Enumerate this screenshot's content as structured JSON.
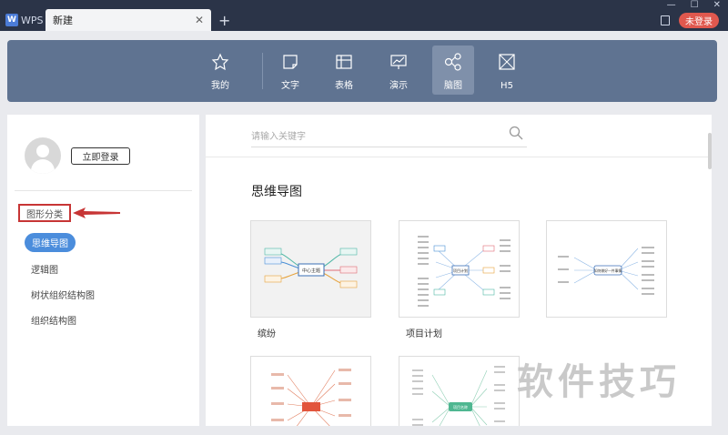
{
  "titlebar": {
    "app_name": "WPS",
    "tab_label": "新建",
    "tab_close": "✕",
    "new_tab": "+",
    "login_badge": "未登录",
    "min": "—",
    "max": "☐",
    "close": "✕"
  },
  "nav": {
    "items": [
      {
        "label": "我的",
        "icon": "star-icon"
      },
      {
        "label": "文字",
        "icon": "document-icon"
      },
      {
        "label": "表格",
        "icon": "table-icon"
      },
      {
        "label": "演示",
        "icon": "presentation-icon"
      },
      {
        "label": "脑图",
        "icon": "mindmap-icon"
      },
      {
        "label": "H5",
        "icon": "h5-icon"
      }
    ],
    "active": "脑图"
  },
  "sidebar": {
    "login_button": "立即登录",
    "category_title": "图形分类",
    "categories": [
      "思维导图",
      "逻辑图",
      "树状组织结构图",
      "组织结构图"
    ]
  },
  "main": {
    "search_placeholder": "请输入关键字",
    "section_title": "思维导图",
    "templates": [
      {
        "label": "缤纷",
        "center_text": "中心主题"
      },
      {
        "label": "项目计划",
        "center_text": "项目计划"
      },
      {
        "label": "",
        "center_text": "如何做好一件事情"
      },
      {
        "label": "",
        "center_text": ""
      },
      {
        "label": "",
        "center_text": "项目名称"
      }
    ]
  },
  "watermark": "软件技巧",
  "colors": {
    "titlebar": "#2b3448",
    "nav": "#5f7391",
    "accent": "#4b8ddc",
    "highlight_red": "#c73535"
  }
}
